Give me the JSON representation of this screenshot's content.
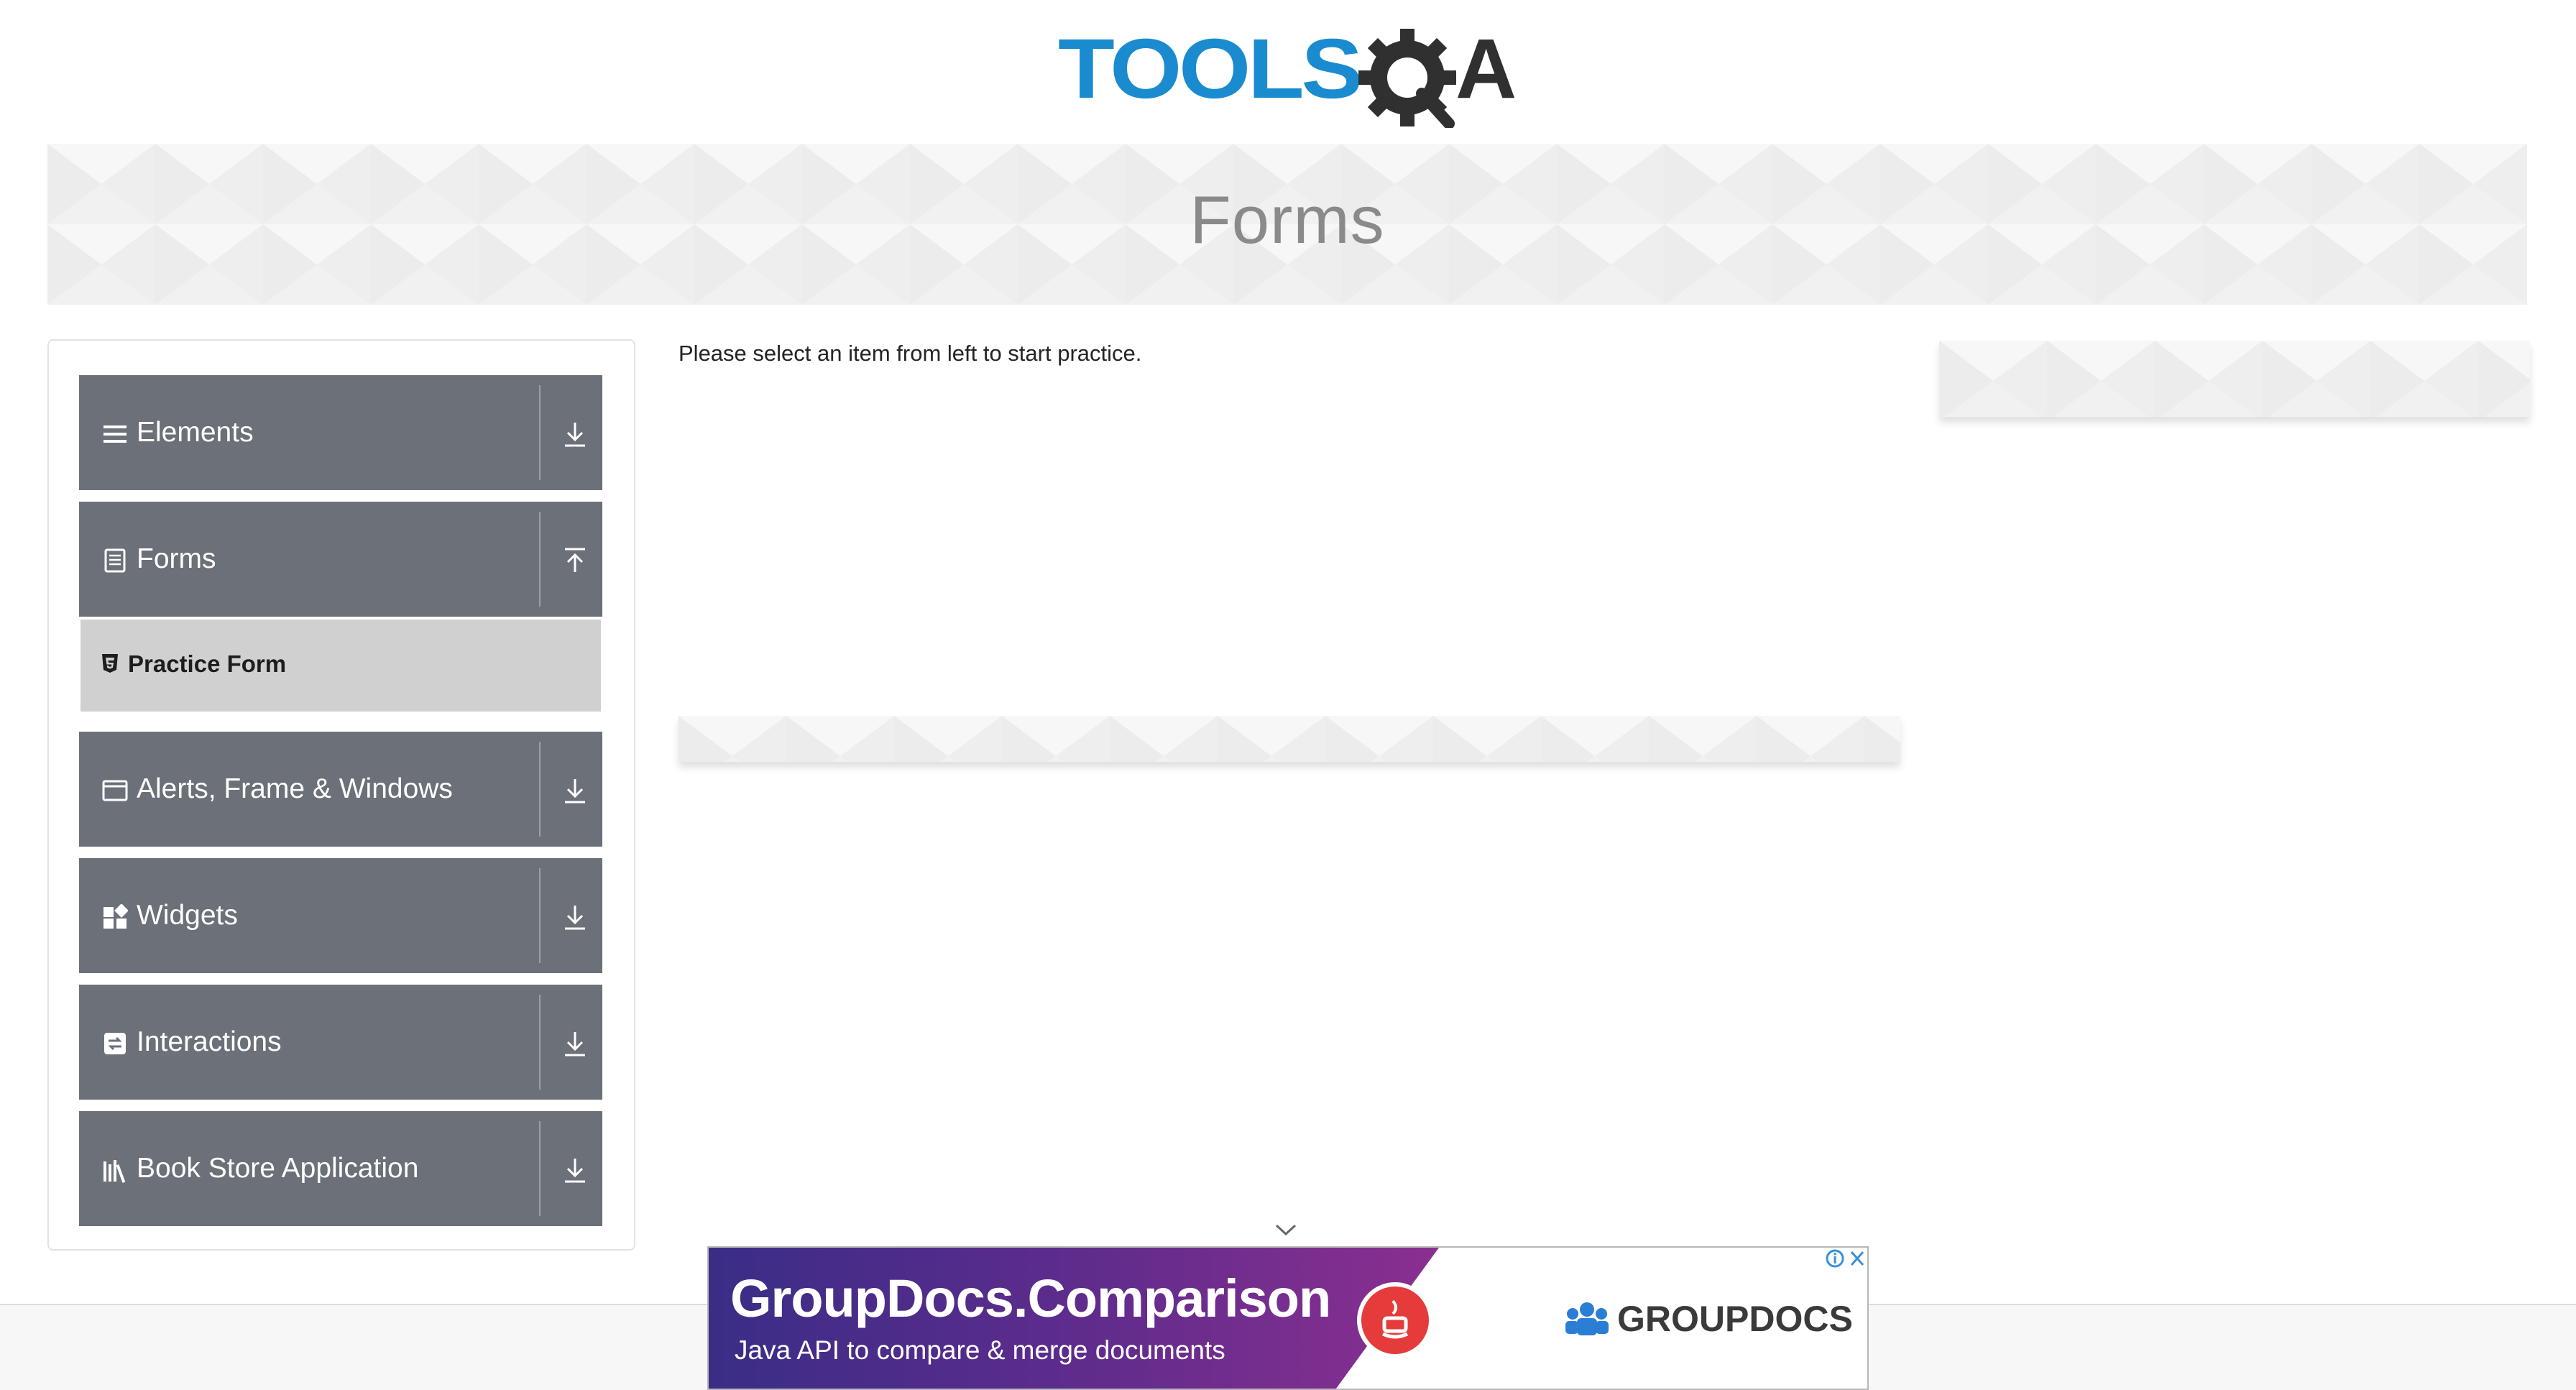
{
  "header": {
    "logo_text": "TOOLSQA"
  },
  "banner": {
    "title": "Forms"
  },
  "sidebar": {
    "groups": [
      {
        "label": "Elements",
        "icon": "hamburger-icon",
        "state": "collapsed"
      },
      {
        "label": "Forms",
        "icon": "document-icon",
        "state": "expanded",
        "items": [
          {
            "label": "Practice Form",
            "icon": "html5-icon"
          }
        ]
      },
      {
        "label": "Alerts, Frame & Windows",
        "icon": "window-icon",
        "state": "collapsed"
      },
      {
        "label": "Widgets",
        "icon": "widgets-icon",
        "state": "collapsed"
      },
      {
        "label": "Interactions",
        "icon": "interactions-icon",
        "state": "collapsed"
      },
      {
        "label": "Book Store Application",
        "icon": "bookshelf-icon",
        "state": "collapsed"
      }
    ]
  },
  "main": {
    "instruction": "Please select an item from left to start practice."
  },
  "bottom_ad": {
    "title": "GroupDocs.Comparison",
    "subtitle": "Java API to compare & merge documents",
    "brand": "GROUPDOCS"
  },
  "colors": {
    "group_header_bg": "#6b7079",
    "active_item_bg": "#d0d0d0",
    "logo_blue": "#1b8bd0",
    "logo_dark": "#303030",
    "ad_purple": "#7a2f8f"
  }
}
